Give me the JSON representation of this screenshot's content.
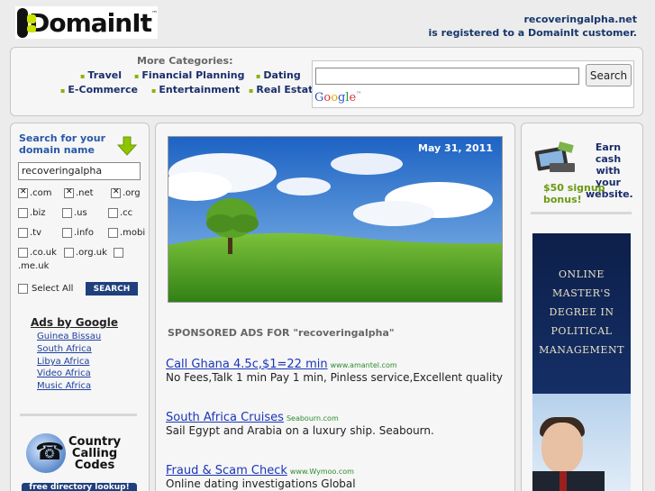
{
  "header": {
    "logo_word": "DomainIt",
    "logo_tm": "™",
    "reg_domain": "recoveringalpha.net",
    "reg_text": "is registered to a DomainIt customer."
  },
  "categories": {
    "title": "More Categories:",
    "items": [
      "Travel",
      "Financial Planning",
      "Dating",
      "E-Commerce",
      "Entertainment",
      "Real Estate"
    ]
  },
  "google": {
    "button": "Search",
    "logo": "Google",
    "logo_tm": "™"
  },
  "domain_search": {
    "title_line1": "Search for your",
    "title_line2": "domain name",
    "input_value": "recoveringalpha",
    "tlds": [
      {
        "label": ".com",
        "checked": true
      },
      {
        "label": ".net",
        "checked": true
      },
      {
        "label": ".org",
        "checked": true
      },
      {
        "label": ".biz",
        "checked": false
      },
      {
        "label": ".us",
        "checked": false
      },
      {
        "label": ".cc",
        "checked": false
      },
      {
        "label": ".tv",
        "checked": false
      },
      {
        "label": ".info",
        "checked": false
      },
      {
        "label": ".mobi",
        "checked": false
      },
      {
        "label": ".co.uk",
        "checked": false
      },
      {
        "label": ".org.uk",
        "checked": false
      },
      {
        "label": ".me.uk",
        "checked": false
      }
    ],
    "select_all": "Select All",
    "search_button": "SEARCH"
  },
  "ads_by_google": {
    "title": "Ads by Google",
    "links": [
      "Guinea Bissau",
      "South Africa",
      "Libya Africa",
      "Video Africa",
      "Music Africa"
    ]
  },
  "country_codes": {
    "line1": "Country",
    "line2": "Calling",
    "line3": "Codes",
    "free_dir": "free directory lookup!"
  },
  "main": {
    "date": "May 31, 2011",
    "sponsored_title": "SPONSORED ADS FOR \"recoveringalpha\"",
    "ads": [
      {
        "title": "Call Ghana 4.5c,$1=22 min",
        "url": "www.amantel.com",
        "desc": "No Fees,Talk 1 min Pay 1 min, Pinless service,Excellent quality"
      },
      {
        "title": "South Africa Cruises",
        "url": "Seabourn.com",
        "desc": "Sail Egypt and Arabia on a luxury ship. Seabourn."
      },
      {
        "title": "Fraud & Scam Check",
        "url": "www.Wymoo.com",
        "desc": "Online dating investigations Global"
      }
    ]
  },
  "right": {
    "earn_line1": "Earn cash",
    "earn_line2": "with your",
    "earn_line3": "website.",
    "bonus": "$50 signup bonus!",
    "banner_lines": [
      "ONLINE",
      "MASTER'S",
      "DEGREE IN",
      "POLITICAL",
      "MANAGEMENT"
    ]
  },
  "colors": {
    "navy": "#1a2d6b",
    "link": "#1a35b8",
    "accent_green": "#8fb000"
  }
}
